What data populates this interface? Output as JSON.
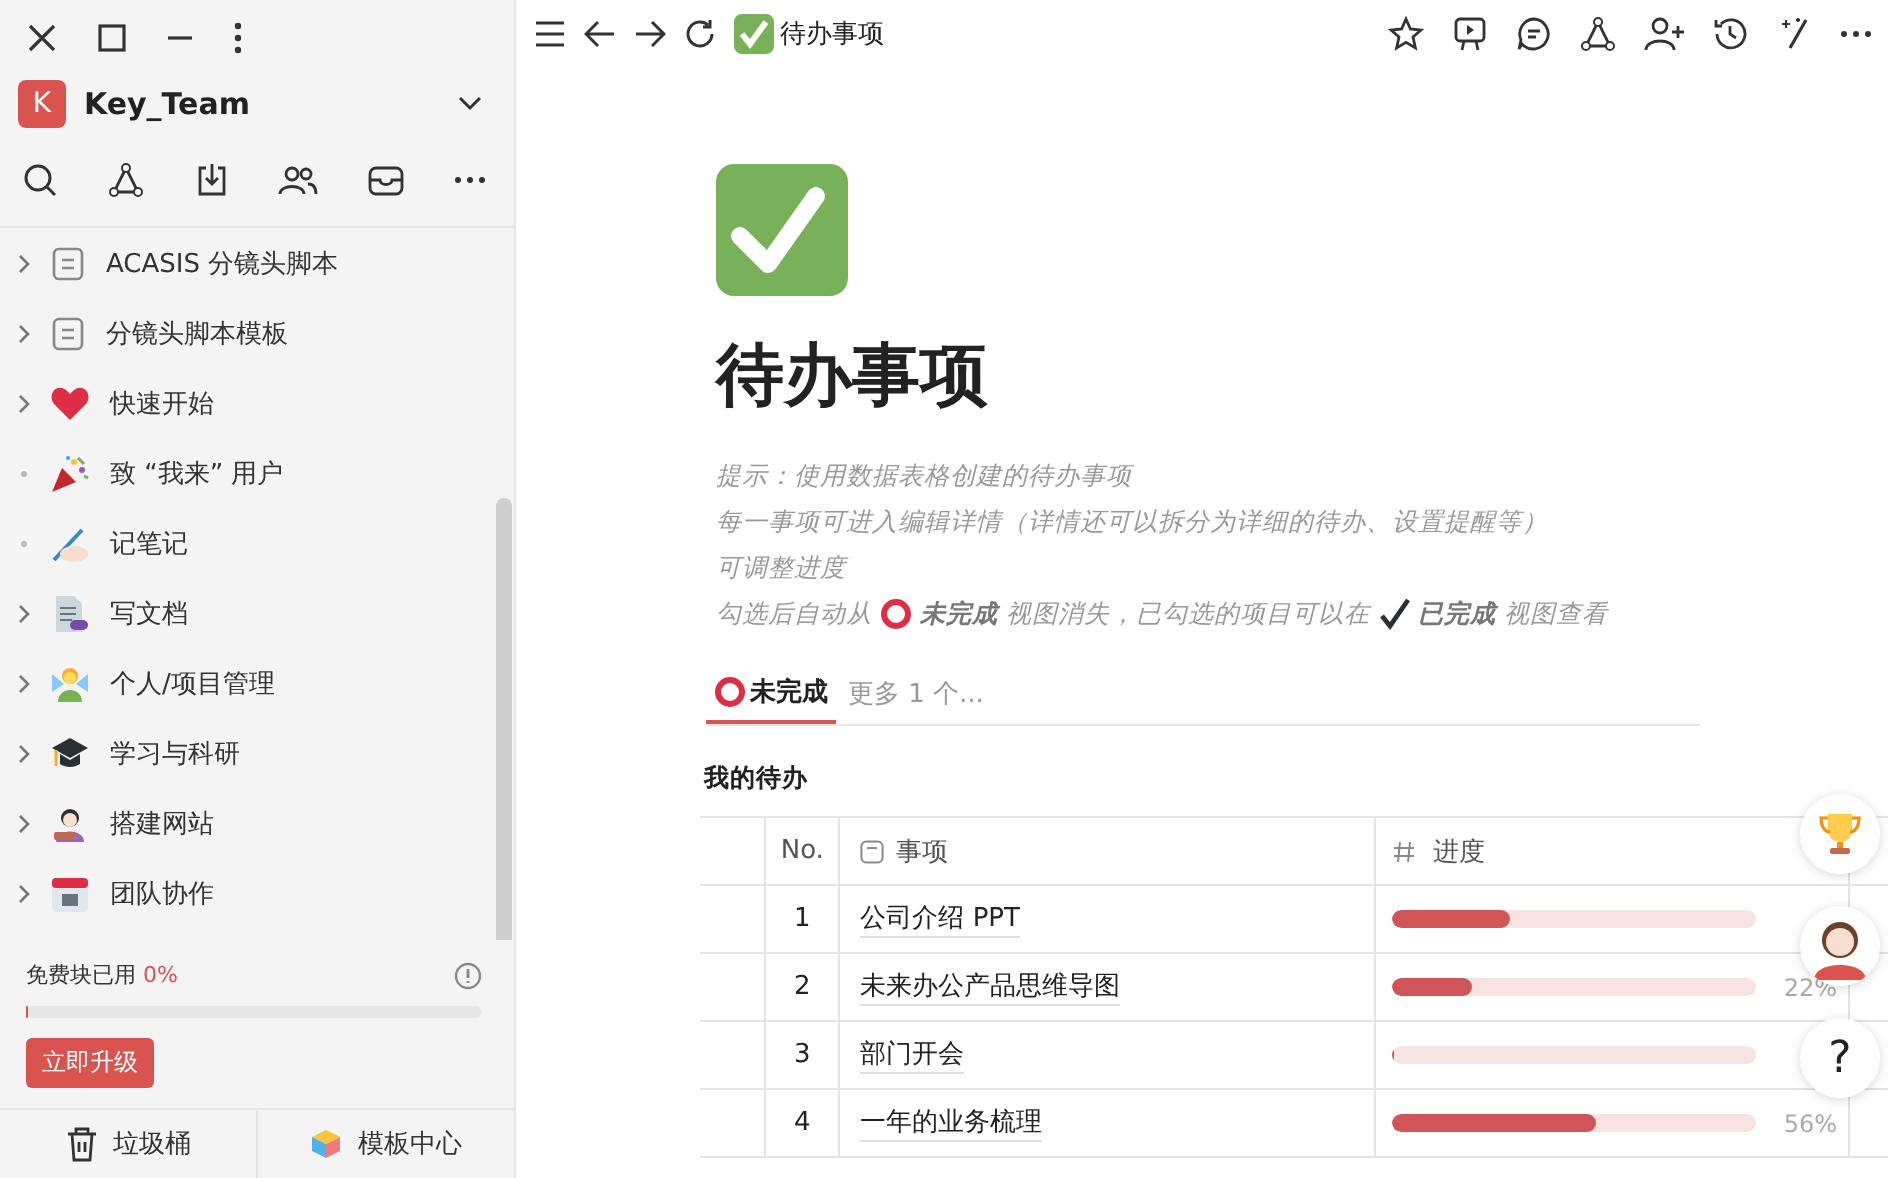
{
  "workspace": {
    "initial": "K",
    "name": "Key_Team"
  },
  "sidebar": {
    "items": [
      {
        "label": "ACASIS 分镜头脚本",
        "kind": "doc",
        "expandable": true
      },
      {
        "label": "分镜头脚本模板",
        "kind": "doc",
        "expandable": true
      },
      {
        "label": "快速开始",
        "kind": "heart",
        "expandable": true
      },
      {
        "label": "致 “我来” 用户",
        "kind": "party",
        "expandable": false
      },
      {
        "label": "记笔记",
        "kind": "writing",
        "expandable": false
      },
      {
        "label": "写文档",
        "kind": "page",
        "expandable": true
      },
      {
        "label": "个人/项目管理",
        "kind": "fairy",
        "expandable": true
      },
      {
        "label": "学习与科研",
        "kind": "cap",
        "expandable": true
      },
      {
        "label": "搭建网站",
        "kind": "artist",
        "expandable": true
      },
      {
        "label": "团队协作",
        "kind": "calendar",
        "expandable": true
      }
    ]
  },
  "quota": {
    "label": "免费块已用",
    "value": "0%",
    "level": 0,
    "upgrade": "立即升级"
  },
  "footer": {
    "trash": "垃圾桶",
    "templates": "模板中心"
  },
  "page": {
    "crumb": "待办事项",
    "title": "待办事项",
    "hints": [
      "提示：使用数据表格创建的待办事项",
      "每一事项可进入编辑详情（详情还可以拆分为详细的待办、设置提醒等）",
      "可调整进度"
    ],
    "hint_last": {
      "before": "勾选后自动从",
      "view1": "未完成",
      "middle": "视图消失，已勾选的项目可以在",
      "view2": "已完成",
      "after": "视图查看"
    },
    "tabs": [
      {
        "label": "未完成",
        "selected": true
      }
    ],
    "more_views": "更多 1 个...",
    "table_title": "我的待办",
    "columns": [
      "No.",
      "事项",
      "进度"
    ],
    "rows": [
      {
        "no": "1",
        "item": "公司介绍 PPT",
        "level": 0.32
      },
      {
        "no": "2",
        "item": "未来办公产品思维导图",
        "level": 0.22,
        "percent": "22%"
      },
      {
        "no": "3",
        "item": "部门开会",
        "level": 0
      },
      {
        "no": "4",
        "item": "一年的业务梳理",
        "level": 0.56,
        "percent": "56%"
      }
    ]
  },
  "help": "?"
}
